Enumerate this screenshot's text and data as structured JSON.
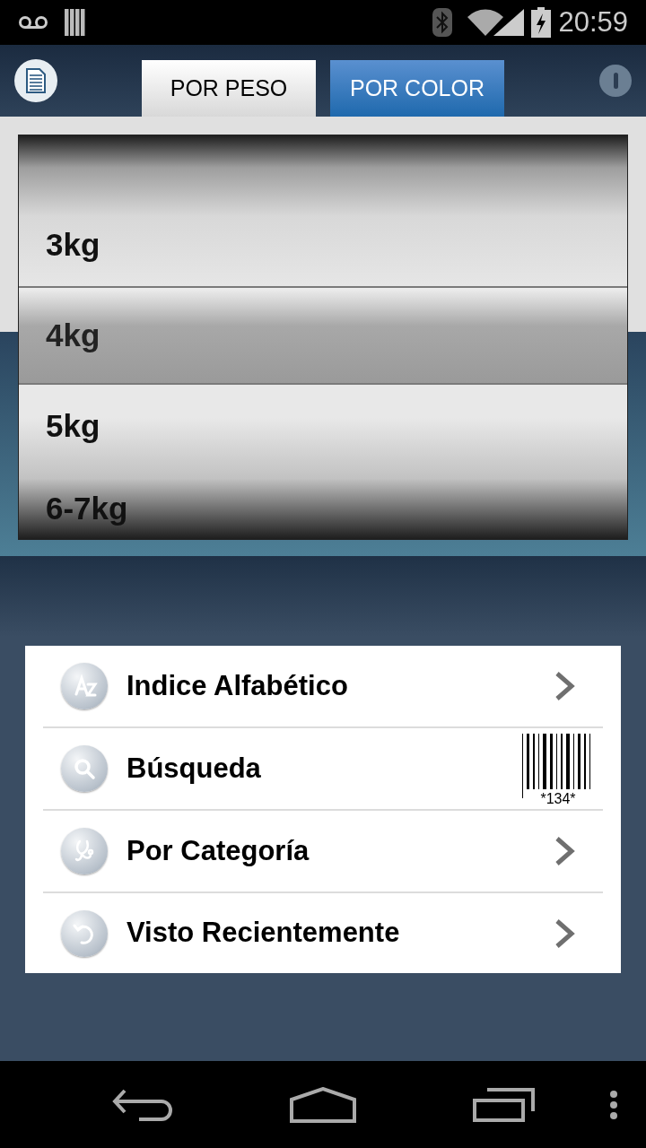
{
  "status_bar": {
    "time": "20:59"
  },
  "tabs": [
    {
      "label": "POR PESO",
      "selected": true
    },
    {
      "label": "POR COLOR",
      "selected": false
    }
  ],
  "picker": {
    "items": [
      {
        "label": "3kg",
        "selected": false
      },
      {
        "label": "4kg",
        "selected": true
      },
      {
        "label": "5kg",
        "selected": false
      },
      {
        "label": "6-7kg",
        "selected": false
      }
    ]
  },
  "menu": [
    {
      "label": "Indice Alfabético",
      "kind": "arrow"
    },
    {
      "label": "Búsqueda",
      "kind": "barcode",
      "code": "*134*"
    },
    {
      "label": "Por Categoría",
      "kind": "arrow"
    },
    {
      "label": "Visto Recientemente",
      "kind": "arrow"
    }
  ]
}
